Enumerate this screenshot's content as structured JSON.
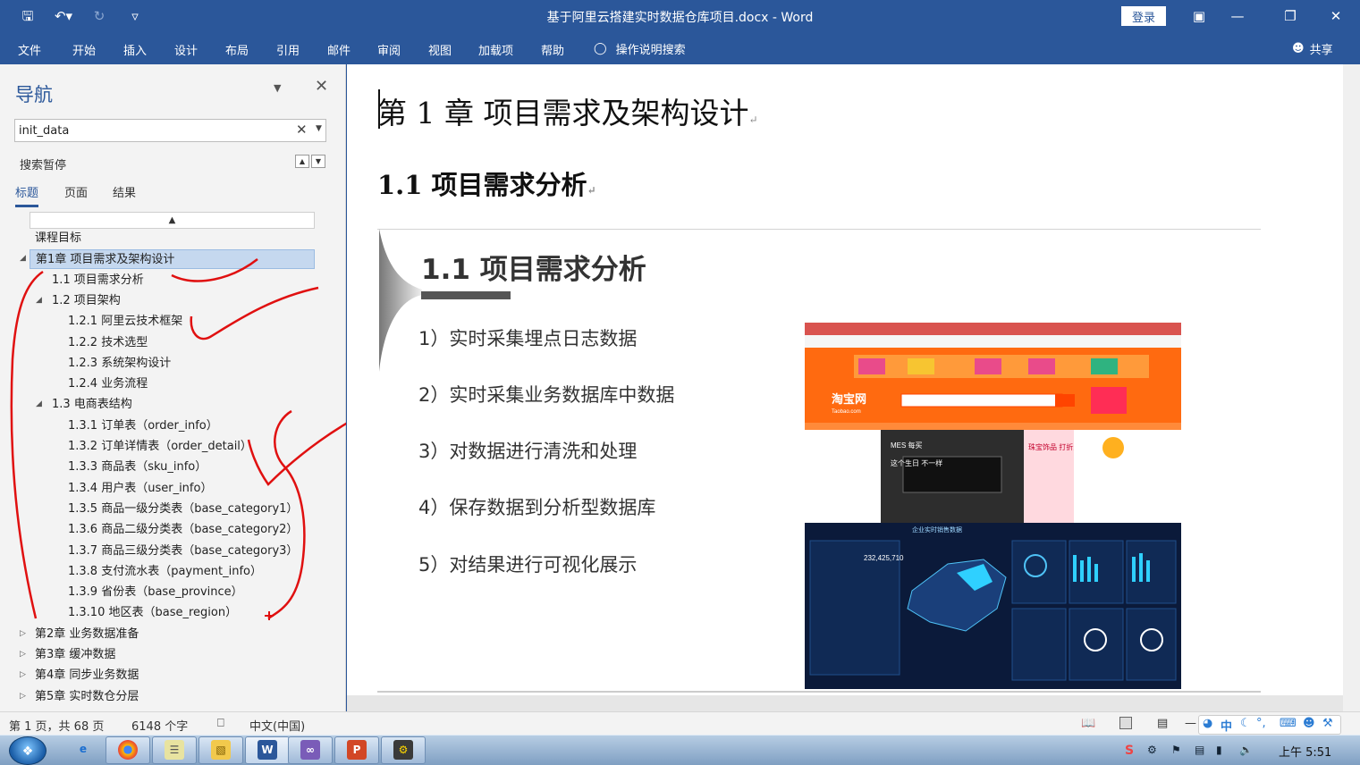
{
  "window": {
    "title": "基于阿里云搭建实时数据仓库项目.docx  -  Word",
    "login_label": "登录",
    "qat_icons": [
      "save-icon",
      "undo-icon",
      "redo-icon",
      "customize-icon"
    ]
  },
  "ribbon": {
    "tabs": [
      "文件",
      "开始",
      "插入",
      "设计",
      "布局",
      "引用",
      "邮件",
      "审阅",
      "视图",
      "加载项",
      "帮助"
    ],
    "tell_me": "操作说明搜索",
    "share": "共享"
  },
  "nav": {
    "title": "导航",
    "search_value": "init_data",
    "search_status": "搜索暂停",
    "tabs": [
      "标题",
      "页面",
      "结果"
    ],
    "tree": [
      {
        "label": "课程目标",
        "level": 0,
        "toggle": ""
      },
      {
        "label": "第1章 项目需求及架构设计",
        "level": 0,
        "toggle": "expanded",
        "selected": true
      },
      {
        "label": "1.1 项目需求分析",
        "level": 1,
        "toggle": ""
      },
      {
        "label": "1.2 项目架构",
        "level": 1,
        "toggle": "expanded"
      },
      {
        "label": "1.2.1 阿里云技术框架",
        "level": 2,
        "toggle": ""
      },
      {
        "label": "1.2.2 技术选型",
        "level": 2,
        "toggle": ""
      },
      {
        "label": "1.2.3 系统架构设计",
        "level": 2,
        "toggle": ""
      },
      {
        "label": "1.2.4 业务流程",
        "level": 2,
        "toggle": ""
      },
      {
        "label": "1.3 电商表结构",
        "level": 1,
        "toggle": "expanded"
      },
      {
        "label": "1.3.1 订单表（order_info）",
        "level": 2,
        "toggle": ""
      },
      {
        "label": "1.3.2 订单详情表（order_detail）",
        "level": 2,
        "toggle": ""
      },
      {
        "label": "1.3.3 商品表（sku_info）",
        "level": 2,
        "toggle": ""
      },
      {
        "label": "1.3.4 用户表（user_info）",
        "level": 2,
        "toggle": ""
      },
      {
        "label": "1.3.5 商品一级分类表（base_category1）",
        "level": 2,
        "toggle": ""
      },
      {
        "label": "1.3.6 商品二级分类表（base_category2）",
        "level": 2,
        "toggle": ""
      },
      {
        "label": "1.3.7 商品三级分类表（base_category3）",
        "level": 2,
        "toggle": ""
      },
      {
        "label": "1.3.8 支付流水表（payment_info）",
        "level": 2,
        "toggle": ""
      },
      {
        "label": "1.3.9 省份表（base_province）",
        "level": 2,
        "toggle": ""
      },
      {
        "label": "1.3.10 地区表（base_region）",
        "level": 2,
        "toggle": ""
      },
      {
        "label": "第2章 业务数据准备",
        "level": 0,
        "toggle": "collapsed"
      },
      {
        "label": "第3章 缓冲数据",
        "level": 0,
        "toggle": "collapsed"
      },
      {
        "label": "第4章 同步业务数据",
        "level": 0,
        "toggle": "collapsed"
      },
      {
        "label": "第5章 实时数仓分层",
        "level": 0,
        "toggle": "collapsed"
      }
    ]
  },
  "document": {
    "heading1": "第 1 章  项目需求及架构设计",
    "heading2": "1.1  项目需求分析",
    "slide": {
      "title": "1.1 项目需求分析",
      "items": [
        "1）实时采集埋点日志数据",
        "2）实时采集业务数据库中数据",
        "3）对数据进行清洗和处理",
        "4）保存数据到分析型数据库",
        "5）对结果进行可视化展示"
      ],
      "screenshot": {
        "taobao_logo": "淘宝网",
        "taobao_domain": "Taobao.com",
        "dashboard_title": "企业实时销售数据",
        "dashboard_total": "232,425,710",
        "promo_text": "这个生日 不一样",
        "jewelry_text": "珠宝饰品 打折满减",
        "brand_text": "MES 每买"
      }
    }
  },
  "status": {
    "page": "第 1 页，共 68 页",
    "words": "6148 个字",
    "lang": "中文(中国)"
  },
  "taskbar": {
    "apps": [
      "ie",
      "chrome",
      "notepad",
      "explorer",
      "word",
      "vs",
      "powerpoint",
      "tool"
    ],
    "clock": "上午 5:51",
    "ime_label": "中"
  },
  "colors": {
    "accent": "#2b579a",
    "selection": "#c5d8ef",
    "annotation": "#e01010"
  }
}
